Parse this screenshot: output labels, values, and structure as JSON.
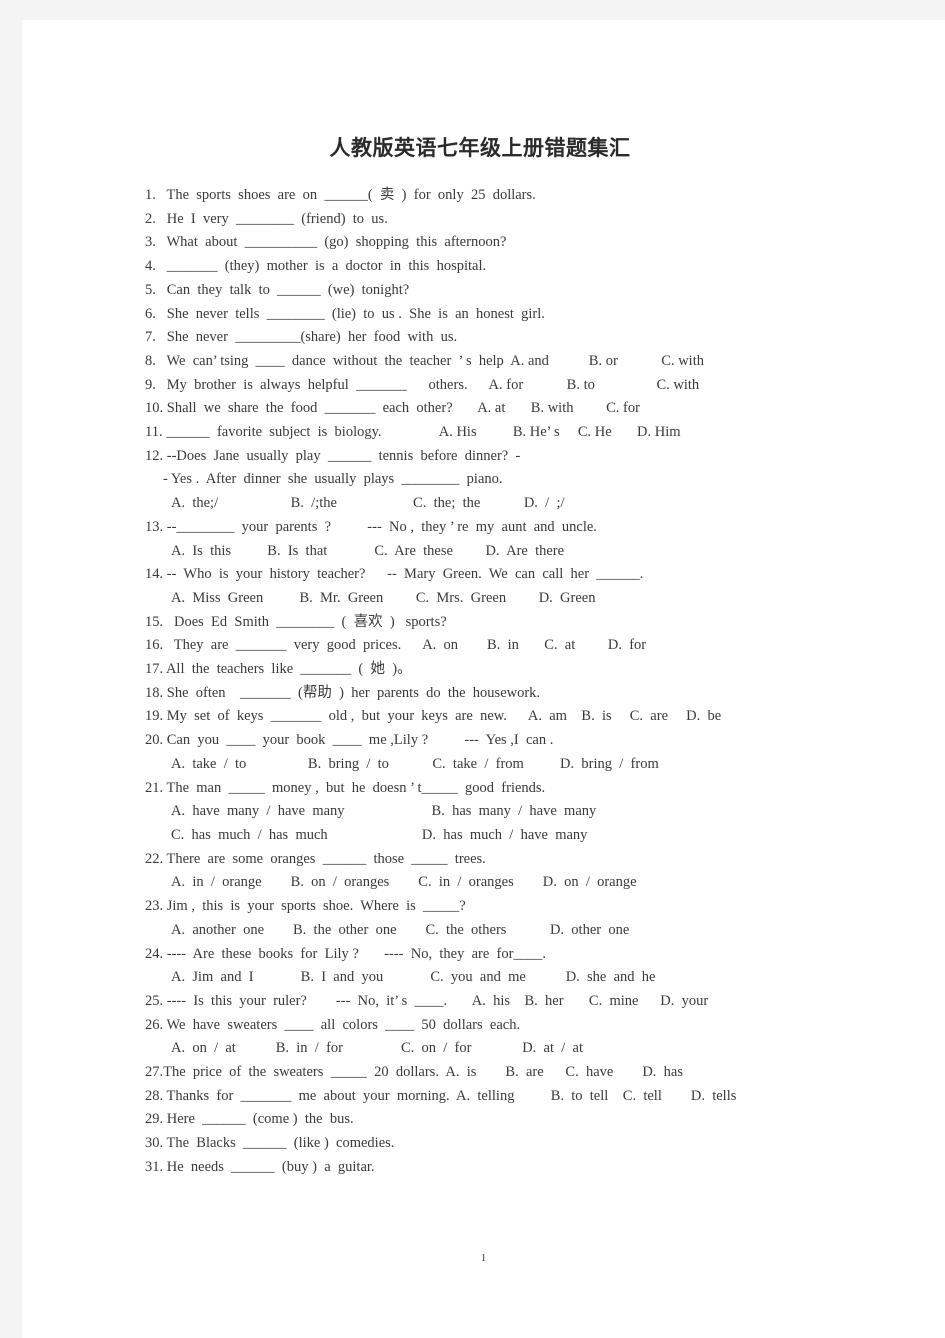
{
  "document": {
    "title": "人教版英语七年级上册错题集汇",
    "page_number": "1"
  },
  "questions": [
    {
      "indent": "none",
      "text": "1.   The  sports  shoes  are  on  ______(  卖  )  for  only  25  dollars."
    },
    {
      "indent": "none",
      "text": "2.   He  I  very  ________  (friend)  to  us."
    },
    {
      "indent": "none",
      "text": "3.   What  about  __________  (go)  shopping  this  afternoon?"
    },
    {
      "indent": "none",
      "text": "4.   _______  (they)  mother  is  a  doctor  in  this  hospital."
    },
    {
      "indent": "none",
      "text": "5.   Can  they  talk  to  ______  (we)  tonight?"
    },
    {
      "indent": "none",
      "text": "6.   She  never  tells  ________  (lie)  to  us .  She  is  an  honest  girl."
    },
    {
      "indent": "none",
      "text": "7.   She  never  _________(share)  her  food  with  us."
    },
    {
      "indent": "none",
      "text": "8.   We  can’ tsing  ____  dance  without  the  teacher  ’ s  help  A. and           B. or            C. with"
    },
    {
      "indent": "none",
      "text": "9.   My  brother  is  always  helpful  _______      others.      A. for            B. to                 C. with"
    },
    {
      "indent": "none",
      "text": "10. Shall  we  share  the  food  _______  each  other?       A. at       B. with         C. for"
    },
    {
      "indent": "none",
      "text": "11. ______  favorite  subject  is  biology.                A. His          B. He’ s     C. He       D. Him"
    },
    {
      "indent": "none",
      "text": "12. --Does  Jane  usually  play  ______  tennis  before  dinner?  -"
    },
    {
      "indent": "sub2",
      "text": "- Yes .  After  dinner  she  usually  plays  ________  piano."
    },
    {
      "indent": "sub",
      "text": "A.  the;/                    B.  /;the                     C.  the;  the            D.  /  ;/"
    },
    {
      "indent": "none",
      "text": "13. --________  your  parents  ?          ---  No ,  they ’ re  my  aunt  and  uncle."
    },
    {
      "indent": "sub",
      "text": "A.  Is  this          B.  Is  that             C.  Are  these         D.  Are  there"
    },
    {
      "indent": "none",
      "text": "14. --  Who  is  your  history  teacher?      --  Mary  Green.  We  can  call  her  ______."
    },
    {
      "indent": "sub",
      "text": "A.  Miss  Green          B.  Mr.  Green         C.  Mrs.  Green         D.  Green"
    },
    {
      "indent": "none",
      "text": "15.   Does  Ed  Smith  ________  (  喜欢  )   sports?"
    },
    {
      "indent": "none",
      "text": "16.   They  are  _______  very  good  prices.      A.  on        B.  in       C.  at         D.  for"
    },
    {
      "indent": "none",
      "text": "17. All  the  teachers  like  _______  (  她  )。"
    },
    {
      "indent": "none",
      "text": "18. She  often    _______  (帮助  )  her  parents  do  the  housework."
    },
    {
      "indent": "none",
      "text": "19. My  set  of  keys  _______  old ,  but  your  keys  are  new.      A.  am    B.  is     C.  are     D.  be"
    },
    {
      "indent": "none",
      "text": "20. Can  you  ____  your  book  ____  me ,Lily ?          ---  Yes ,I  can ."
    },
    {
      "indent": "sub",
      "text": "A.  take  /  to                 B.  bring  /  to            C.  take  /  from          D.  bring  /  from"
    },
    {
      "indent": "none",
      "text": "21. The  man  _____  money ,  but  he  doesn ’ t_____  good  friends."
    },
    {
      "indent": "sub",
      "text": "A.  have  many  /  have  many                        B.  has  many  /  have  many"
    },
    {
      "indent": "sub",
      "text": "C.  has  much  /  has  much                          D.  has  much  /  have  many"
    },
    {
      "indent": "none",
      "text": "22. There  are  some  oranges  ______  those  _____  trees."
    },
    {
      "indent": "sub",
      "text": "A.  in  /  orange        B.  on  /  oranges        C.  in  /  oranges        D.  on  /  orange"
    },
    {
      "indent": "none",
      "text": "23. Jim ,  this  is  your  sports  shoe.  Where  is  _____?"
    },
    {
      "indent": "sub",
      "text": "A.  another  one        B.  the  other  one        C.  the  others            D.  other  one"
    },
    {
      "indent": "none",
      "text": "24. ----  Are  these  books  for  Lily ?       ----  No,  they  are  for____."
    },
    {
      "indent": "sub",
      "text": "A.  Jim  and  I             B.  I  and  you             C.  you  and  me           D.  she  and  he"
    },
    {
      "indent": "none",
      "text": "25. ----  Is  this  your  ruler?        ---  No,  it’ s  ____.       A.  his    B.  her       C.  mine      D.  your"
    },
    {
      "indent": "none",
      "text": "26. We  have  sweaters  ____  all  colors  ____  50  dollars  each."
    },
    {
      "indent": "sub",
      "text": "A.  on  /  at           B.  in  /  for                C.  on  /  for              D.  at  /  at"
    },
    {
      "indent": "none",
      "text": "27.The  price  of  the  sweaters  _____  20  dollars.  A.  is        B.  are      C.  have        D.  has"
    },
    {
      "indent": "none",
      "text": "28. Thanks  for  _______  me  about  your  morning.  A.  telling          B.  to  tell    C.  tell        D.  tells"
    },
    {
      "indent": "none",
      "text": "29. Here  ______  (come )  the  bus."
    },
    {
      "indent": "none",
      "text": "30. The  Blacks  ______  (like )  comedies."
    },
    {
      "indent": "none",
      "text": "31. He  needs  ______  (buy )  a  guitar."
    }
  ]
}
